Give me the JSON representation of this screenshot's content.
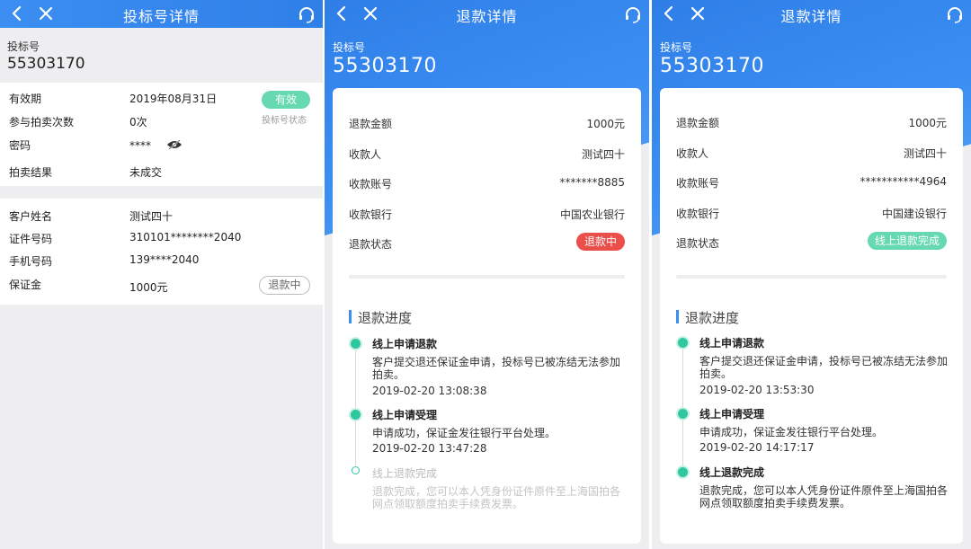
{
  "panel1": {
    "title": "投标号详情",
    "bid_label": "投标号",
    "bid_number": "55303170",
    "rows1": [
      {
        "label": "有效期",
        "value": "2019年08月31日"
      },
      {
        "label": "参与拍卖次数",
        "value": "0次"
      },
      {
        "label": "密码",
        "value": "****"
      },
      {
        "label": "拍卖结果",
        "value": "未成交"
      }
    ],
    "status_badge": "有效",
    "status_caption": "投标号状态",
    "rows2": [
      {
        "label": "客户姓名",
        "value": "测试四十"
      },
      {
        "label": "证件号码",
        "value": "310101********2040"
      },
      {
        "label": "手机号码",
        "value": "139****2040"
      },
      {
        "label": "保证金",
        "value": "1000元"
      }
    ],
    "refund_button": "退款中"
  },
  "panel2": {
    "title": "退款详情",
    "bid_label": "投标号",
    "bid_number": "55303170",
    "rows": [
      {
        "label": "退款金额",
        "value": "1000元"
      },
      {
        "label": "收款人",
        "value": "测试四十"
      },
      {
        "label": "收款账号",
        "value": "*******8885"
      },
      {
        "label": "收款银行",
        "value": "中国农业银行"
      }
    ],
    "status_label": "退款状态",
    "status_value": "退款中",
    "progress_title": "退款进度",
    "steps": [
      {
        "title": "线上申请退款",
        "desc": "客户提交退还保证金申请，投标号已被冻结无法参加拍卖。",
        "time": "2019-02-20 13:08:38"
      },
      {
        "title": "线上申请受理",
        "desc": "申请成功，保证金发往银行平台处理。",
        "time": "2019-02-20 13:47:28"
      },
      {
        "title": "线上退款完成",
        "desc": "退款完成，您可以本人凭身份证件原件至上海国拍各网点领取额度拍卖手续费发票。",
        "time": ""
      }
    ]
  },
  "panel3": {
    "title": "退款详情",
    "bid_label": "投标号",
    "bid_number": "55303170",
    "rows": [
      {
        "label": "退款金额",
        "value": "1000元"
      },
      {
        "label": "收款人",
        "value": "测试四十"
      },
      {
        "label": "收款账号",
        "value": "***********4964"
      },
      {
        "label": "收款银行",
        "value": "中国建设银行"
      }
    ],
    "status_label": "退款状态",
    "status_value": "线上退款完成",
    "progress_title": "退款进度",
    "steps": [
      {
        "title": "线上申请退款",
        "desc": "客户提交退还保证金申请，投标号已被冻结无法参加拍卖。",
        "time": "2019-02-20 13:53:30"
      },
      {
        "title": "线上申请受理",
        "desc": "申请成功，保证金发往银行平台处理。",
        "time": "2019-02-20 14:17:17"
      },
      {
        "title": "线上退款完成",
        "desc": "退款完成，您可以本人凭身份证件原件至上海国拍各网点领取额度拍卖手续费发票。",
        "time": ""
      }
    ]
  },
  "colors": {
    "brand_blue": "#3b8ff2",
    "success_teal": "#2ec7a0",
    "badge_green": "#66d9b0",
    "danger_red": "#ea4f4a"
  },
  "icons": [
    "back-arrow-icon",
    "close-icon",
    "headset-support-icon",
    "eye-hidden-icon"
  ]
}
